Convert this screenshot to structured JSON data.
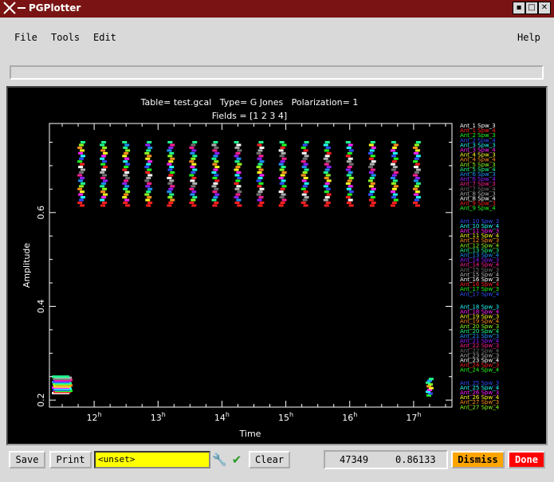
{
  "window": {
    "title": "PGPlotter",
    "controls": [
      "minimize",
      "maximize",
      "close"
    ]
  },
  "menu": {
    "file": "File",
    "tools": "Tools",
    "edit": "Edit",
    "help": "Help"
  },
  "plot": {
    "title_line1": "Table= test.gcal   Type= G Jones   Polarization= 1",
    "title_line2": "Fields = [1 2 3 4]",
    "xlabel": "Time",
    "ylabel": "Amplitude",
    "x_ticks": [
      "12h",
      "13h",
      "14h",
      "15h",
      "16h",
      "17h"
    ],
    "y_ticks": [
      "0.2",
      "0.4",
      "0.6"
    ]
  },
  "chart_data": {
    "type": "scatter",
    "xlabel": "Time",
    "ylabel": "Amplitude",
    "xlim": [
      11.3,
      17.6
    ],
    "ylim": [
      0.185,
      0.79
    ],
    "x_unit": "hours",
    "time_columns": [
      11.5,
      11.8,
      12.15,
      12.5,
      12.85,
      13.2,
      13.55,
      13.9,
      14.25,
      14.6,
      14.95,
      15.3,
      15.65,
      16.0,
      16.35,
      16.7,
      17.05,
      17.25
    ],
    "legend": [
      {
        "name": "Ant_1 Spw_3",
        "color": "#ffffff"
      },
      {
        "name": "Ant_1 Spw_4",
        "color": "#ff2020"
      },
      {
        "name": "Ant_2 Spw_3",
        "color": "#20ff20"
      },
      {
        "name": "Ant_2 Spw_4",
        "color": "#3050ff"
      },
      {
        "name": "Ant_3 Spw_3",
        "color": "#20ffff"
      },
      {
        "name": "Ant_3 Spw_4",
        "color": "#ff20ff"
      },
      {
        "name": "Ant_4 Spw_3",
        "color": "#ffff20"
      },
      {
        "name": "Ant_4 Spw_4",
        "color": "#ff9020"
      },
      {
        "name": "Ant_5 Spw_3",
        "color": "#90ff20"
      },
      {
        "name": "Ant_5 Spw_4",
        "color": "#20ff90"
      },
      {
        "name": "Ant_6 Spw_3",
        "color": "#2090ff"
      },
      {
        "name": "Ant_6 Spw_4",
        "color": "#9020ff"
      },
      {
        "name": "Ant_7 Spw_3",
        "color": "#ff2090"
      },
      {
        "name": "Ant_7 Spw_4",
        "color": "#707070"
      },
      {
        "name": "Ant_8 Spw_3",
        "color": "#b0b0b0"
      },
      {
        "name": "Ant_8 Spw_4",
        "color": "#ffffff"
      },
      {
        "name": "Ant_9 Spw_3",
        "color": "#ff2020"
      },
      {
        "name": "Ant_9 Spw_4",
        "color": "#20ff20"
      },
      {
        "name": "Ant_10 Spw_3",
        "color": "#3050ff"
      },
      {
        "name": "Ant_10 Spw_4",
        "color": "#20ffff"
      },
      {
        "name": "Ant_11 Spw_3",
        "color": "#ff20ff"
      },
      {
        "name": "Ant_11 Spw_4",
        "color": "#ffff20"
      },
      {
        "name": "Ant_12 Spw_3",
        "color": "#ff9020"
      },
      {
        "name": "Ant_12 Spw_4",
        "color": "#90ff20"
      },
      {
        "name": "Ant_13 Spw_3",
        "color": "#20ff90"
      },
      {
        "name": "Ant_13 Spw_4",
        "color": "#2090ff"
      },
      {
        "name": "Ant_14 Spw_3",
        "color": "#9020ff"
      },
      {
        "name": "Ant_14 Spw_4",
        "color": "#ff2090"
      },
      {
        "name": "Ant_15 Spw_3",
        "color": "#707070"
      },
      {
        "name": "Ant_15 Spw_4",
        "color": "#b0b0b0"
      },
      {
        "name": "Ant_16 Spw_3",
        "color": "#ffffff"
      },
      {
        "name": "Ant_16 Spw_4",
        "color": "#ff2020"
      },
      {
        "name": "Ant_17 Spw_3",
        "color": "#20ff20"
      },
      {
        "name": "Ant_17 Spw_4",
        "color": "#3050ff"
      },
      {
        "name": "Ant_18 Spw_3",
        "color": "#20ffff"
      },
      {
        "name": "Ant_18 Spw_4",
        "color": "#ff20ff"
      },
      {
        "name": "Ant_19 Spw_3",
        "color": "#ffff20"
      },
      {
        "name": "Ant_19 Spw_4",
        "color": "#ff9020"
      },
      {
        "name": "Ant_20 Spw_3",
        "color": "#90ff20"
      },
      {
        "name": "Ant_20 Spw_4",
        "color": "#20ff90"
      },
      {
        "name": "Ant_21 Spw_3",
        "color": "#2090ff"
      },
      {
        "name": "Ant_21 Spw_4",
        "color": "#9020ff"
      },
      {
        "name": "Ant_22 Spw_3",
        "color": "#ff2090"
      },
      {
        "name": "Ant_22 Spw_4",
        "color": "#707070"
      },
      {
        "name": "Ant_23 Spw_3",
        "color": "#b0b0b0"
      },
      {
        "name": "Ant_23 Spw_4",
        "color": "#ffffff"
      },
      {
        "name": "Ant_24 Spw_3",
        "color": "#ff2020"
      },
      {
        "name": "Ant_24 Spw_4",
        "color": "#20ff20"
      },
      {
        "name": "Ant_25 Spw_3",
        "color": "#3050ff"
      },
      {
        "name": "Ant_25 Spw_4",
        "color": "#20ffff"
      },
      {
        "name": "Ant_26 Spw_3",
        "color": "#ff20ff"
      },
      {
        "name": "Ant_26 Spw_4",
        "color": "#ffff20"
      },
      {
        "name": "Ant_27 Spw_3",
        "color": "#ff9020"
      },
      {
        "name": "Ant_27 Spw_4",
        "color": "#90ff20"
      }
    ]
  },
  "toolbar": {
    "save": "Save",
    "print": "Print",
    "field_value": "<unset>",
    "clear": "Clear",
    "readout_x": "47349",
    "readout_y": "0.86133",
    "dismiss": "Dismiss",
    "done": "Done"
  },
  "colors": {
    "titlebar": "#7a1414",
    "field": "#ffff00",
    "dismiss": "#ffa500",
    "done": "#ff0000",
    "check": "#2a9a2a"
  }
}
